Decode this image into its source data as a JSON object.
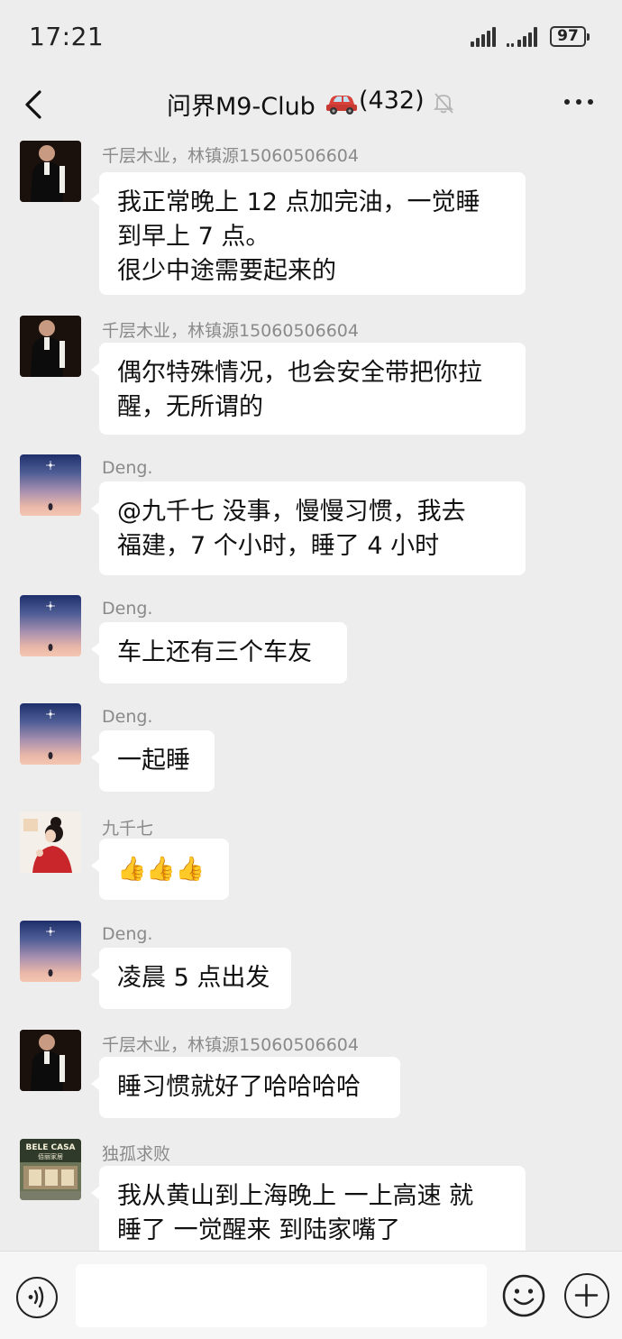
{
  "status_bar": {
    "time": "17:21",
    "battery": "97"
  },
  "header": {
    "title": "问界M9-Club",
    "member_count": "(432)",
    "back_icon": "chevron-left-icon",
    "car_icon": "car-emoji-icon",
    "mute_icon": "bell-off-icon",
    "more_icon": "more-dots-icon"
  },
  "messages": [
    {
      "sender": "千层木业，林镇源15060506604",
      "lines": [
        "我正常晚上 12 点加完油，一觉睡",
        "到早上 7 点。",
        "很少中途需要起来的"
      ]
    },
    {
      "sender": "千层木业，林镇源15060506604",
      "lines": [
        "偶尔特殊情况，也会安全带把你拉",
        "醒，无所谓的"
      ]
    },
    {
      "sender": "Deng.",
      "lines": [
        "@九千七  没事，慢慢习惯，我去",
        "福建，7 个小时，睡了 4 小时"
      ]
    },
    {
      "sender": "Deng.",
      "lines": [
        "车上还有三个车友"
      ]
    },
    {
      "sender": "Deng.",
      "lines": [
        "一起睡"
      ]
    },
    {
      "sender": "九千七",
      "lines": [
        "👍👍👍"
      ]
    },
    {
      "sender": "Deng.",
      "lines": [
        "凌晨 5 点出发"
      ]
    },
    {
      "sender": "千层木业，林镇源15060506604",
      "lines": [
        "睡习惯就好了哈哈哈哈"
      ]
    },
    {
      "sender": "独孤求败",
      "lines": [
        "我从黄山到上海晚上 一上高速 就",
        "睡了   一觉醒来 到陆家嘴了"
      ]
    }
  ],
  "shop_avatar_text": [
    "BELE CASA",
    "佰丽家居"
  ],
  "input_bar": {
    "voice_icon": "voice-icon",
    "emoji_icon": "smile-icon",
    "plus_icon": "plus-circle-icon"
  }
}
